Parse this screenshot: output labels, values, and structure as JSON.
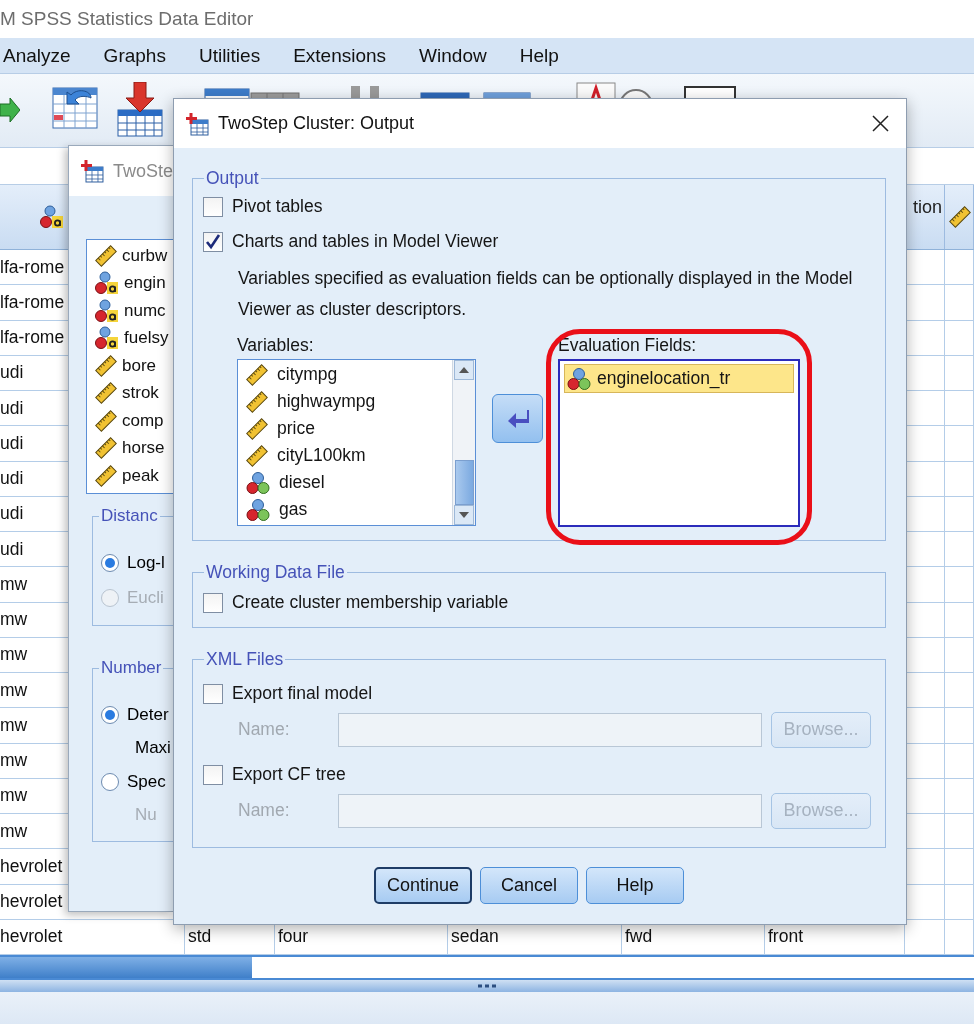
{
  "app_title": "M SPSS Statistics Data Editor",
  "menu": [
    "Analyze",
    "Graphs",
    "Utilities",
    "Extensions",
    "Window",
    "Help"
  ],
  "grid": {
    "header": [
      {
        "kind": "string_nominal"
      },
      {
        "kind": "text",
        "text": "tion"
      },
      {
        "kind": "scale"
      }
    ],
    "rows": [
      [
        "lfa-rome"
      ],
      [
        "lfa-rome"
      ],
      [
        "lfa-rome"
      ],
      [
        "udi"
      ],
      [
        "udi"
      ],
      [
        "udi"
      ],
      [
        "udi"
      ],
      [
        "udi"
      ],
      [
        "udi"
      ],
      [
        "mw"
      ],
      [
        "mw"
      ],
      [
        "mw"
      ],
      [
        "mw"
      ],
      [
        "mw"
      ],
      [
        "mw"
      ],
      [
        "mw"
      ],
      [
        "mw"
      ],
      [
        "hevrolet"
      ],
      [
        "hevrolet"
      ],
      [
        "hevrolet",
        "std",
        "four",
        "sedan",
        "fwd",
        "front"
      ]
    ]
  },
  "back_dialog": {
    "title": "TwoSte",
    "variables": [
      {
        "name": "curbw",
        "kind": "scale"
      },
      {
        "name": "engin",
        "kind": "string_nominal"
      },
      {
        "name": "numc",
        "kind": "string_nominal"
      },
      {
        "name": "fuelsy",
        "kind": "string_nominal"
      },
      {
        "name": "bore",
        "kind": "scale"
      },
      {
        "name": "strok",
        "kind": "scale"
      },
      {
        "name": "comp",
        "kind": "scale"
      },
      {
        "name": "horse",
        "kind": "scale"
      },
      {
        "name": "peak",
        "kind": "scale"
      }
    ],
    "distance": {
      "title": "Distanc",
      "options": [
        {
          "label": "Log-l",
          "selected": true,
          "disabled": false
        },
        {
          "label": "Eucli",
          "selected": false,
          "disabled": true
        }
      ]
    },
    "number": {
      "title": "Number",
      "options": [
        {
          "label": "Deter",
          "selected": true,
          "disabled": false,
          "sub": "Maxi",
          "sub_disabled": false
        },
        {
          "label": "Spec",
          "selected": false,
          "disabled": false,
          "sub": "Nu",
          "sub_disabled": true
        }
      ]
    }
  },
  "dialog": {
    "title": "TwoStep Cluster: Output",
    "output_group": {
      "title": "Output",
      "options": [
        {
          "label": "Pivot tables",
          "checked": false
        },
        {
          "label": "Charts and tables in Model Viewer",
          "checked": true
        }
      ],
      "description": "Variables specified as evaluation fields can be optionally displayed in the Model Viewer as cluster descriptors.",
      "variables_label": "Variables:",
      "variables": [
        {
          "name": "citympg",
          "kind": "scale"
        },
        {
          "name": "highwaympg",
          "kind": "scale"
        },
        {
          "name": "price",
          "kind": "scale"
        },
        {
          "name": "cityL100km",
          "kind": "scale"
        },
        {
          "name": "diesel",
          "kind": "nominal"
        },
        {
          "name": "gas",
          "kind": "nominal"
        }
      ],
      "evaluation_label": "Evaluation Fields:",
      "evaluation_fields": [
        {
          "name": "enginelocation_tr",
          "kind": "nominal",
          "selected": true
        }
      ]
    },
    "working_group": {
      "title": "Working Data File",
      "options": [
        {
          "label": "Create cluster membership variable",
          "checked": false
        }
      ]
    },
    "xml_group": {
      "title": "XML Files",
      "exports": [
        {
          "label": "Export final model",
          "checked": false,
          "name_label": "Name:",
          "browse": "Browse...",
          "disabled": true
        },
        {
          "label": "Export CF tree",
          "checked": false,
          "name_label": "Name:",
          "browse": "Browse...",
          "disabled": true
        }
      ]
    },
    "buttons": [
      {
        "label": "Continue",
        "default": true
      },
      {
        "label": "Cancel",
        "default": false
      },
      {
        "label": "Help",
        "default": false
      }
    ]
  }
}
